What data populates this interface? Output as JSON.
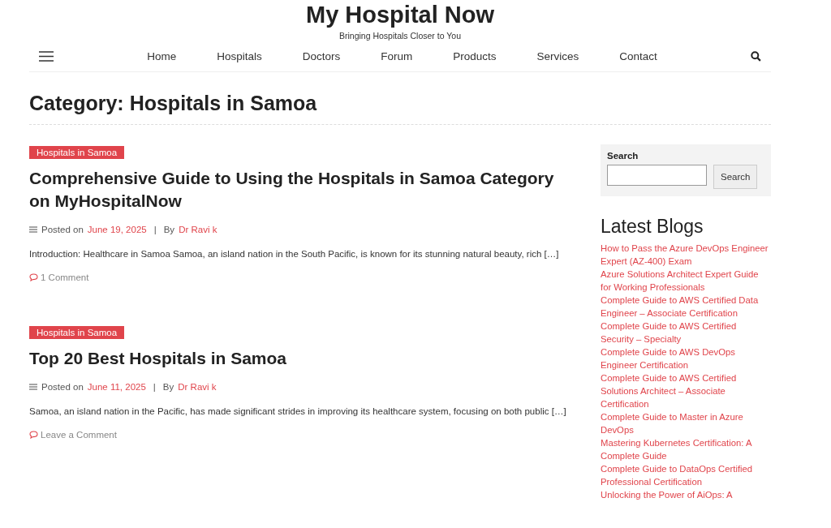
{
  "site": {
    "title": "My Hospital Now",
    "tagline": "Bringing Hospitals Closer to You"
  },
  "nav": [
    "Home",
    "Hospitals",
    "Doctors",
    "Forum",
    "Products",
    "Services",
    "Contact"
  ],
  "page_title": "Category: Hospitals in Samoa",
  "posts": [
    {
      "category": "Hospitals in Samoa",
      "title": "Comprehensive Guide to Using the Hospitals in Samoa Category on MyHospitalNow",
      "posted_label": "Posted on",
      "date": "June 19, 2025",
      "separator": "|",
      "by_label": "By",
      "author": "Dr Ravi k",
      "excerpt": "Introduction: Healthcare in Samoa Samoa, an island nation in the South Pacific, is known for its stunning natural beauty, rich […]",
      "comments": "1 Comment"
    },
    {
      "category": "Hospitals in Samoa",
      "title": "Top 20 Best Hospitals in Samoa",
      "posted_label": "Posted on",
      "date": "June 11, 2025",
      "separator": "|",
      "by_label": "By",
      "author": "Dr Ravi k",
      "excerpt": "Samoa, an island nation in the Pacific, has made significant strides in improving its healthcare system, focusing on both public […]",
      "comments": "Leave a Comment"
    }
  ],
  "sidebar": {
    "search_label": "Search",
    "search_button": "Search",
    "blogs_heading": "Latest Blogs",
    "blogs": [
      "How to Pass the Azure DevOps Engineer Expert (AZ-400) Exam",
      "Azure Solutions Architect Expert Guide for Working Professionals",
      "Complete Guide to AWS Certified Data Engineer – Associate Certification",
      "Complete Guide to AWS Certified Security – Specialty",
      "Complete Guide to AWS DevOps Engineer Certification",
      "Complete Guide to AWS Certified Solutions Architect – Associate Certification",
      "Complete Guide to Master in Azure DevOps",
      "Mastering Kubernetes Certification: A Complete Guide",
      "Complete Guide to DataOps Certified Professional Certification",
      "Unlocking the Power of AiOps: A"
    ]
  }
}
